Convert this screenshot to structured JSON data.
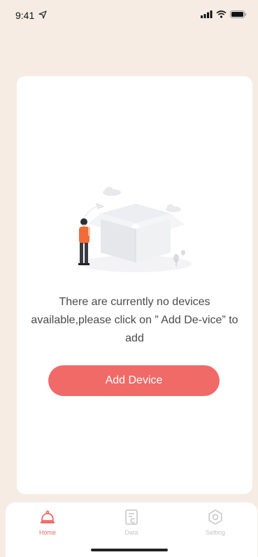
{
  "status_bar": {
    "time": "9:41",
    "icons": [
      "location-icon",
      "signal-icon",
      "wifi-icon",
      "battery-icon"
    ]
  },
  "empty_state": {
    "message": "There are currently no devices available,please click on ” Add De-vice” to add",
    "button_label": "Add Device"
  },
  "tab_bar": {
    "tabs": [
      {
        "label": "Home",
        "icon": "home-bell-icon",
        "active": true
      },
      {
        "label": "Data",
        "icon": "data-icon",
        "active": false
      },
      {
        "label": "Setting",
        "icon": "gear-icon",
        "active": false
      }
    ]
  },
  "colors": {
    "background": "#f6ece4",
    "accent": "#f06a68",
    "inactive": "#c4c4c4"
  }
}
